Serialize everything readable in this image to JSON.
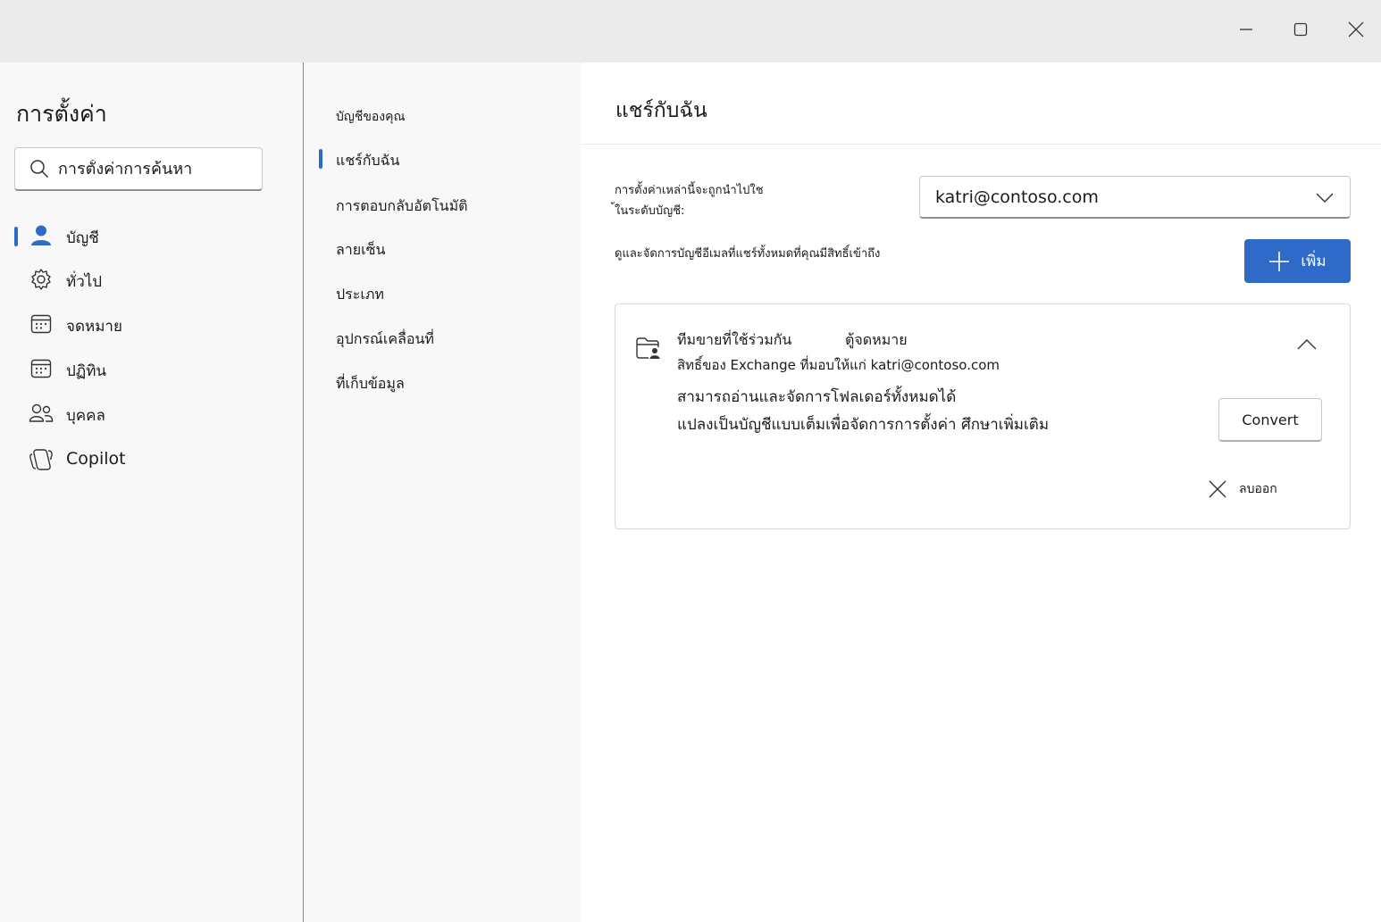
{
  "window": {
    "minimize_icon": "minimize-icon",
    "maximize_icon": "maximize-icon",
    "close_icon": "close-icon"
  },
  "sidebar": {
    "title": "การตั้งค่า",
    "search_placeholder": "การตั้งค่าการค้นหา",
    "items": [
      {
        "label": "บัญชี",
        "icon": "person-icon",
        "selected": true
      },
      {
        "label": "ทั่วไป",
        "icon": "gear-icon",
        "selected": false
      },
      {
        "label": "จดหมาย",
        "icon": "mail-icon",
        "selected": false
      },
      {
        "label": "ปฏิทิน",
        "icon": "calendar-icon",
        "selected": false
      },
      {
        "label": "บุคคล",
        "icon": "people-icon",
        "selected": false
      },
      {
        "label": "Copilot",
        "icon": "copilot-icon",
        "selected": false
      }
    ]
  },
  "subnav": {
    "items": [
      {
        "label": "บัญชีของคุณ",
        "selected": false
      },
      {
        "label": "แชร์กับฉัน",
        "selected": true
      },
      {
        "label": "การตอบกลับอัตโนมัติ",
        "selected": false
      },
      {
        "label": "ลายเซ็น",
        "selected": false
      },
      {
        "label": "ประเภท",
        "selected": false
      },
      {
        "label": "อุปกรณ์เคลื่อนที่",
        "selected": false
      },
      {
        "label": "ที่เก็บข้อมูล",
        "selected": false
      }
    ]
  },
  "main": {
    "title": "แชร์กับฉัน",
    "apply_note_line1": "การตั้งค่าเหล่านี้จะถูกนำไปใช",
    "apply_note_line2": "้ในระดับบัญชี:",
    "account_selected": "katri@contoso.com",
    "manage_description": "ดูและจัดการบัญชีอีเมลที่แชร์ทั้งหมดที่คุณมีสิทธิ์เข้าถึง",
    "add_label": "เพิ่ม",
    "card": {
      "title": "ทีมขายที่ใช้ร่วมกัน",
      "type": "ตู้จดหมาย",
      "permission": "สิทธิ์ของ Exchange ที่มอบให้แก่ katri@contoso.com",
      "line1": "สามารถอ่านและจัดการโฟลเดอร์ทั้งหมดได้",
      "line2": "แปลงเป็นบัญชีแบบเต็มเพื่อจัดการการตั้งค่า",
      "learn_more": "ศึกษาเพิ่มเติม",
      "convert_label": "Convert",
      "remove_label": "ลบออก"
    }
  },
  "colors": {
    "accent": "#2f6ac8",
    "titlebar": "#ebebeb",
    "pane": "#f8f8f8"
  }
}
